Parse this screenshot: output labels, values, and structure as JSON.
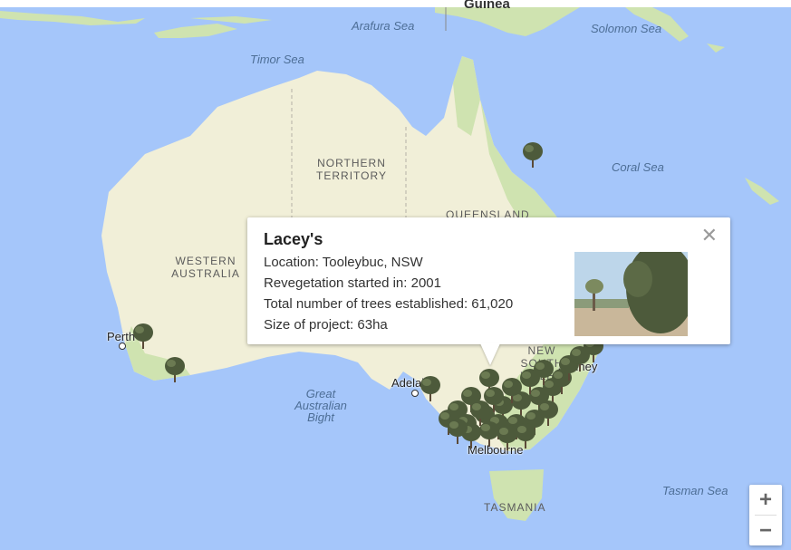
{
  "map": {
    "seas": {
      "arafura": "Arafura Sea",
      "solomon": "Solomon Sea",
      "timor": "Timor Sea",
      "coral": "Coral Sea",
      "great_australian_bight": "Great Australian Bight",
      "tasman": "Tasman Sea"
    },
    "regions": {
      "northern_territory": "NORTHERN TERRITORY",
      "queensland": "QUEENSLAND",
      "western_australia": "WESTERN AUSTRALIA",
      "new_south_wales": "NEW SOUTH WALES",
      "tasmania": "TASMANIA",
      "guinea_fragment": "Guinea"
    },
    "cities": {
      "perth": "Perth",
      "adelaide": "Adelaide",
      "sydney": "Sydney",
      "melbourne": "Melbourne"
    },
    "marker_icon": "tree-marker-icon"
  },
  "infowindow": {
    "title": "Lacey's",
    "location": "Location: Tooleybuc, NSW",
    "revegetation": "Revegetation started in: 2001",
    "trees": "Total number of trees established: 61,020",
    "size": "Size of project: 63ha",
    "close_icon": "close-icon",
    "photo_icon": "project-photo"
  },
  "zoom": {
    "zoom_in": "+",
    "zoom_out": "−"
  },
  "colors": {
    "water": "#a5c6fa",
    "land": "#f1efd8",
    "vegetation": "#cfe3b0",
    "tree": "#4d5a3b"
  }
}
